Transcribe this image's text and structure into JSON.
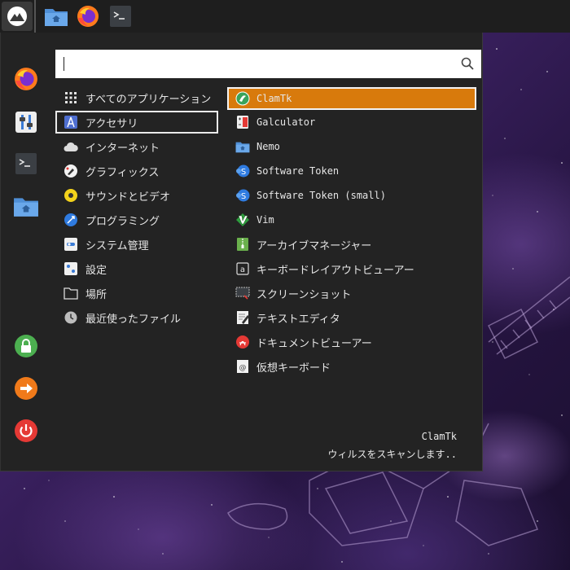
{
  "taskbar": {
    "launchers": [
      "start-menu-icon",
      "file-manager-icon",
      "firefox-icon",
      "terminal-icon"
    ]
  },
  "sidebar": {
    "favorites": [
      "firefox-icon",
      "settings-icon",
      "terminal-icon",
      "folder-icon"
    ],
    "session": [
      "lock-icon",
      "logout-icon",
      "power-icon"
    ]
  },
  "search": {
    "value": "",
    "placeholder": ""
  },
  "categories": [
    {
      "label": "すべてのアプリケーション",
      "icon": "grid-icon"
    },
    {
      "label": "アクセサリ",
      "icon": "accessories-icon",
      "selected": true
    },
    {
      "label": "インターネット",
      "icon": "cloud-icon"
    },
    {
      "label": "グラフィックス",
      "icon": "graphics-icon"
    },
    {
      "label": "サウンドとビデオ",
      "icon": "multimedia-icon"
    },
    {
      "label": "プログラミング",
      "icon": "programming-icon"
    },
    {
      "label": "システム管理",
      "icon": "system-icon"
    },
    {
      "label": "設定",
      "icon": "preferences-icon"
    },
    {
      "label": "場所",
      "icon": "places-icon"
    },
    {
      "label": "最近使ったファイル",
      "icon": "recent-icon"
    }
  ],
  "apps": [
    {
      "label": "ClamTk",
      "icon": "clamtk-icon",
      "selected": true
    },
    {
      "label": "Galculator",
      "icon": "calculator-icon"
    },
    {
      "label": "Nemo",
      "icon": "nemo-icon"
    },
    {
      "label": "Software Token",
      "icon": "software-token-icon"
    },
    {
      "label": "Software Token (small)",
      "icon": "software-token-icon"
    },
    {
      "label": "Vim",
      "icon": "vim-icon"
    },
    {
      "label": "アーカイブマネージャー",
      "icon": "archive-icon"
    },
    {
      "label": "キーボードレイアウトビューアー",
      "icon": "keyboard-layout-icon"
    },
    {
      "label": "スクリーンショット",
      "icon": "screenshot-icon"
    },
    {
      "label": "テキストエディタ",
      "icon": "text-editor-icon"
    },
    {
      "label": "ドキュメントビューアー",
      "icon": "document-viewer-icon"
    },
    {
      "label": "仮想キーボード",
      "icon": "virtual-keyboard-icon"
    }
  ],
  "description": {
    "title": "ClamTk",
    "text": "ウィルスをスキャンします.."
  },
  "colors": {
    "accent": "#d87a0c",
    "panel": "#232323",
    "taskbar": "#1e1e1e"
  }
}
